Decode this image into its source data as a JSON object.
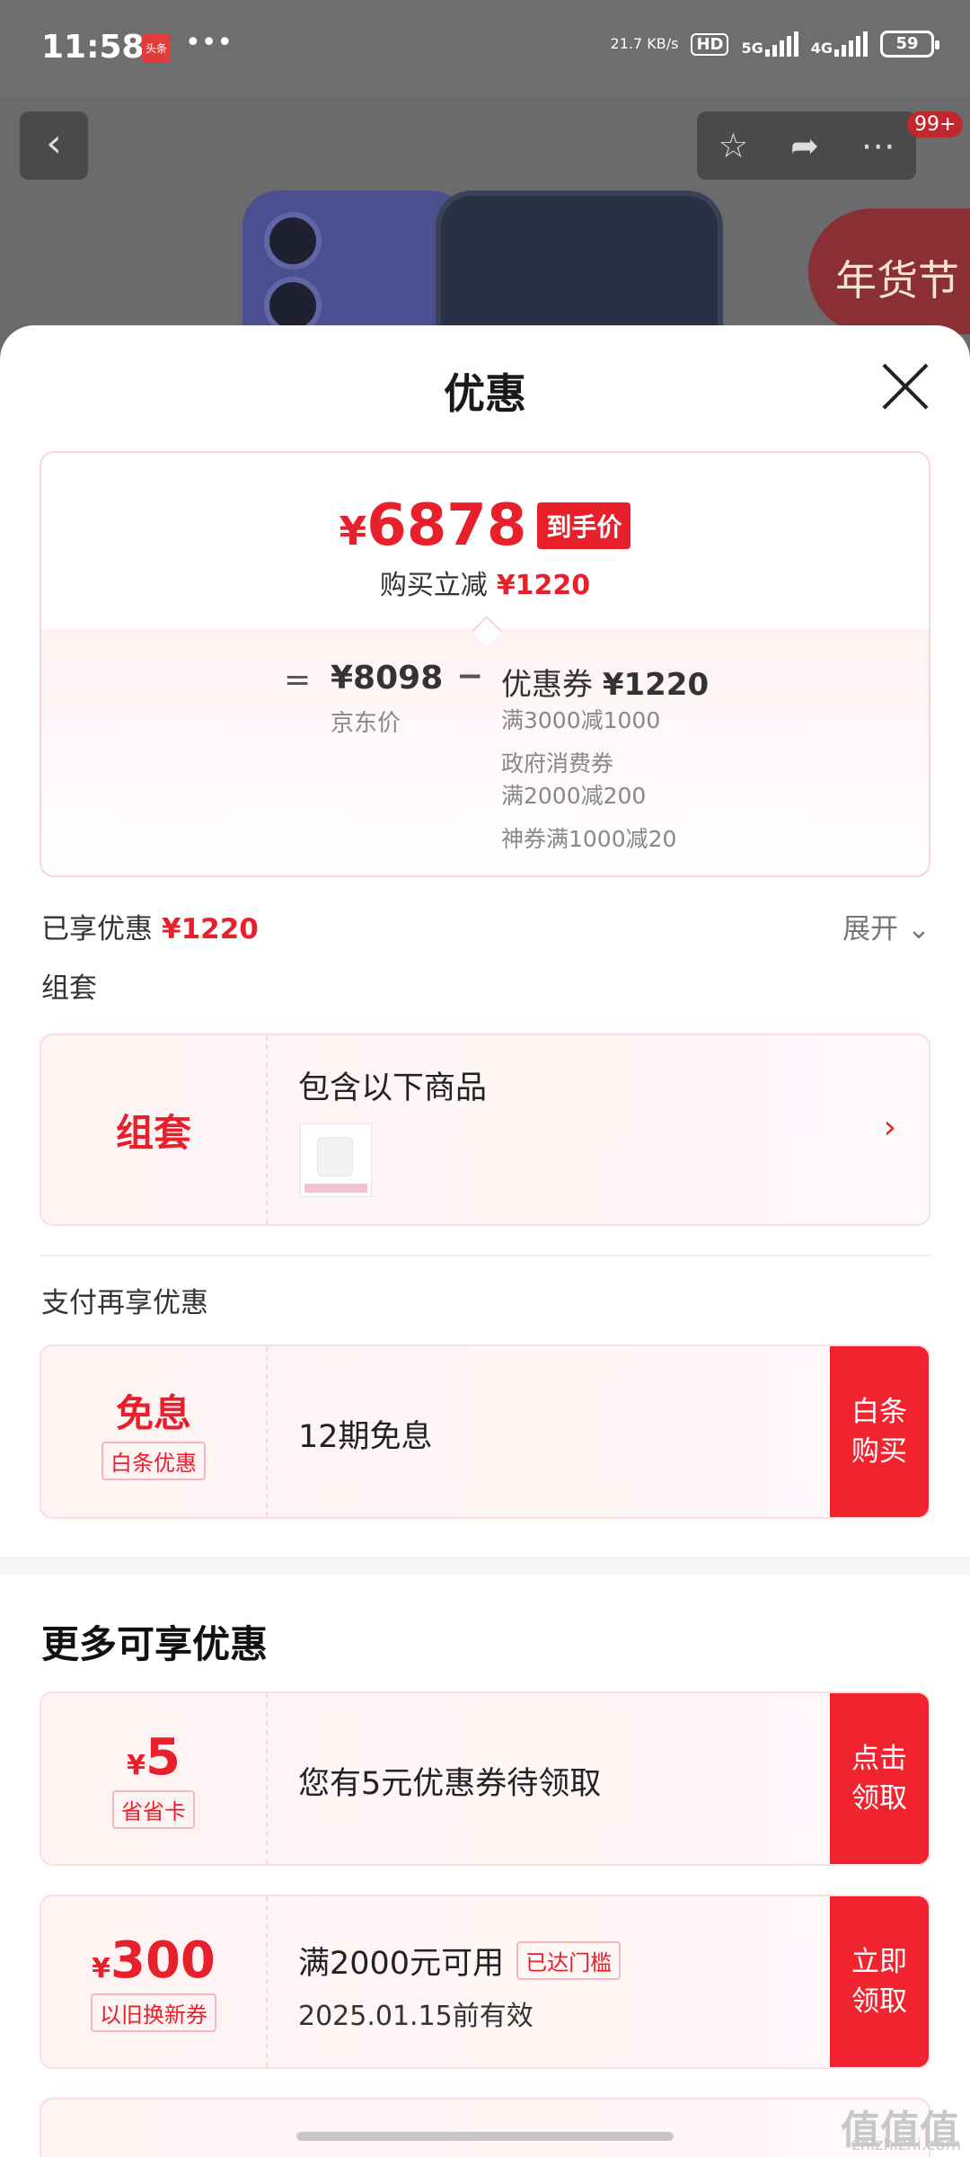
{
  "status_bar": {
    "time": "11:58",
    "app_badge": "头条",
    "more": "•••",
    "speed": "21.7 KB/s",
    "hd": "HD",
    "net1": "5G",
    "net2": "4G",
    "battery": "59"
  },
  "product_header": {
    "cart_badge": "99+",
    "promo_badge": "年货节"
  },
  "sheet": {
    "title": "优惠",
    "price_card": {
      "final_price": "6878",
      "currency": "¥",
      "final_tag": "到手价",
      "save_label": "购买立减",
      "save_amount": "¥1220",
      "equals": "=",
      "jd_price": "¥8098",
      "jd_label": "京东价",
      "minus": "−",
      "coupon_label": "优惠券",
      "coupon_amount": "¥1220",
      "coupon_lines": [
        "满3000减1000",
        "政府消费券\n满2000减200",
        "神券满1000减20"
      ]
    },
    "enjoyed_label": "已享优惠",
    "enjoyed_amount": "¥1220",
    "expand_label": "展开",
    "bundle_section": "组套",
    "bundle_card": {
      "left": "组套",
      "title": "包含以下商品"
    },
    "pay_section": "支付再享优惠",
    "pay_card": {
      "big": "免息",
      "tag": "白条优惠",
      "title": "12期免息",
      "button": "白条\n购买"
    },
    "more_heading": "更多可享优惠",
    "coupon_card1": {
      "yen": "¥",
      "amount": "5",
      "tag": "省省卡",
      "title": "您有5元优惠券待领取",
      "button": "点击\n领取"
    },
    "coupon_card2": {
      "yen": "¥",
      "amount": "300",
      "tag": "以旧换新券",
      "title": "满2000元可用",
      "status": "已达门槛",
      "valid": "2025.01.15前有效",
      "button": "立即\n领取"
    }
  },
  "watermark": {
    "mark": "值值值",
    "url": "zhizhizhi.com"
  },
  "colors": {
    "accent": "#e8202c",
    "button": "#f1232e"
  }
}
